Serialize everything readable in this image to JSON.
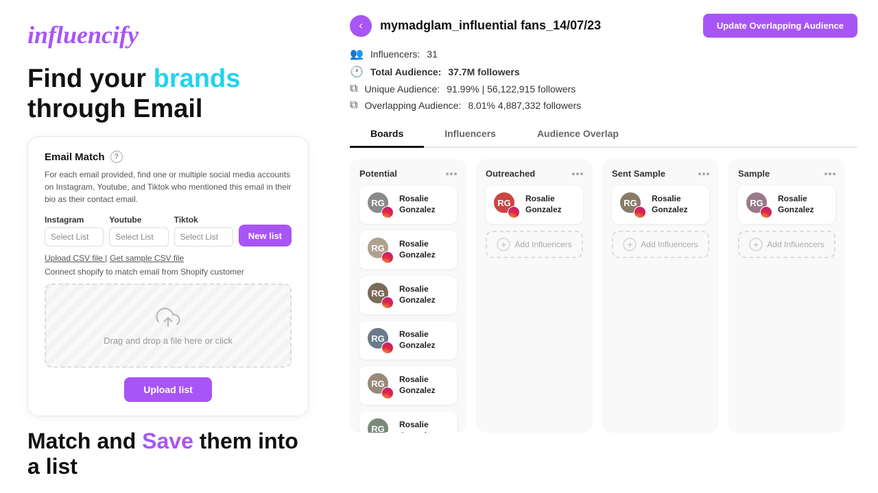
{
  "left": {
    "logo": "influencify",
    "headline_part1": "Find your ",
    "headline_brands": "brands",
    "headline_part2": " through Email",
    "card": {
      "title": "Email Match",
      "description": "For each email provided, find one or multiple social media accounts on Instagram, Youtube, and Tiktok who mentioned this email in their bio as their contact email.",
      "instagram_label": "Instagram",
      "youtube_label": "Youtube",
      "tiktok_label": "Tiktok",
      "select_placeholder": "Select List",
      "new_list_label": "New list",
      "upload_csv_label": "Upload CSV file |",
      "sample_csv_label": "Get sample CSV file",
      "shopify_label": "Connect shopify to match email from Shopify customer",
      "dropzone_text": "Drag and drop a file here or click",
      "upload_btn_label": "Upload list"
    },
    "footer_part1": "Match and ",
    "footer_save": "Save",
    "footer_part2": " them into a list"
  },
  "right": {
    "back_icon": "‹",
    "page_title": "mymadglam_influential fans_14/07/23",
    "update_btn_label": "Update Overlapping Audience",
    "stats": {
      "influencers_label": "Influencers:",
      "influencers_count": "31",
      "total_audience_label": "Total Audience:",
      "total_audience_value": "37.7M followers",
      "unique_label": "Unique Audience:",
      "unique_value": "91.99% | 56,122,915 followers",
      "overlap_label": "Overlapping Audience:",
      "overlap_value": "8.01%  4,887,332 followers"
    },
    "tabs": [
      {
        "label": "Boards",
        "active": true
      },
      {
        "label": "Influencers",
        "active": false
      },
      {
        "label": "Audience Overlap",
        "active": false
      }
    ],
    "boards": [
      {
        "title": "Potential",
        "influencers": [
          {
            "name": "Rosalie Gonzalez",
            "av": "RG",
            "color": "#8a8a8a"
          },
          {
            "name": "Rosalie Gonzalez",
            "av": "RG",
            "color": "#b0a090"
          },
          {
            "name": "Rosalie Gonzalez",
            "av": "RG",
            "color": "#7a6a5a"
          },
          {
            "name": "Rosalie Gonzalez",
            "av": "RG",
            "color": "#9a8a7a"
          },
          {
            "name": "Rosalie Gonzalez",
            "av": "RG",
            "color": "#8a7a6a"
          },
          {
            "name": "Rosalie Gonzalez",
            "av": "RG",
            "color": "#6a7a8a"
          }
        ],
        "add_label": ""
      },
      {
        "title": "Outreached",
        "influencers": [
          {
            "name": "Rosalie Gonzalez",
            "av": "RG",
            "color": "#cc4444"
          }
        ],
        "add_label": "Add Influencers"
      },
      {
        "title": "Sent Sample",
        "influencers": [
          {
            "name": "Rosalie Gonzalez",
            "av": "RG",
            "color": "#8a8a8a"
          }
        ],
        "add_label": "Add Influencers"
      },
      {
        "title": "Sample",
        "influencers": [
          {
            "name": "Rosalie Gonzalez",
            "av": "RG",
            "color": "#9a7a9a"
          }
        ],
        "add_label": "Add Influencers"
      }
    ]
  }
}
